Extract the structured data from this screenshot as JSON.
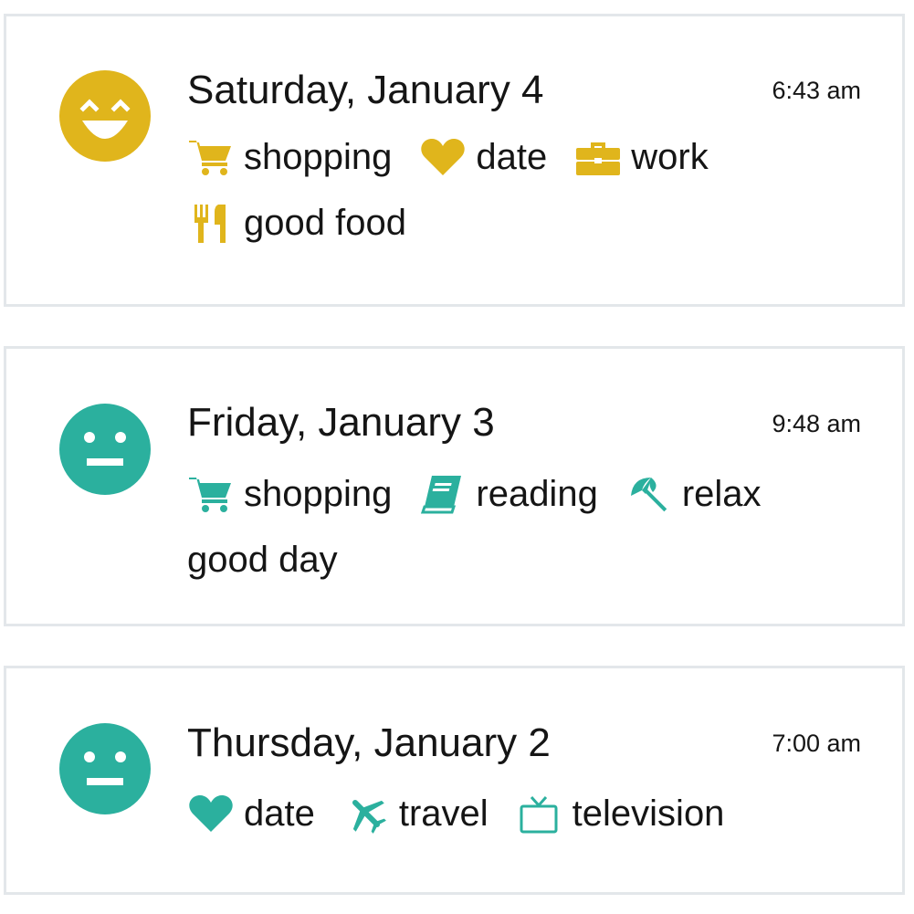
{
  "colors": {
    "yellow": "#e0b51c",
    "teal": "#2bb09e",
    "border": "#e3e7ea",
    "text": "#151515"
  },
  "entries": [
    {
      "mood_icon": "happy-face-icon",
      "mood_color": "#e0b51c",
      "date": "Saturday, January 4",
      "time": "6:43 am",
      "tags": [
        {
          "icon": "shopping-cart-icon",
          "label": "shopping"
        },
        {
          "icon": "heart-icon",
          "label": "date"
        },
        {
          "icon": "briefcase-icon",
          "label": "work"
        },
        {
          "icon": "fork-knife-icon",
          "label": "good food"
        }
      ]
    },
    {
      "mood_icon": "neutral-face-icon",
      "mood_color": "#2bb09e",
      "date": "Friday, January 3",
      "time": "9:48 am",
      "tags": [
        {
          "icon": "shopping-cart-icon",
          "label": "shopping"
        },
        {
          "icon": "book-icon",
          "label": "reading"
        },
        {
          "icon": "beach-umbrella-icon",
          "label": "relax"
        }
      ],
      "note": "good day"
    },
    {
      "mood_icon": "neutral-face-icon",
      "mood_color": "#2bb09e",
      "date": "Thursday, January 2",
      "time": "7:00 am",
      "tags": [
        {
          "icon": "heart-icon",
          "label": "date"
        },
        {
          "icon": "airplane-icon",
          "label": "travel"
        },
        {
          "icon": "television-icon",
          "label": "television"
        }
      ]
    }
  ]
}
